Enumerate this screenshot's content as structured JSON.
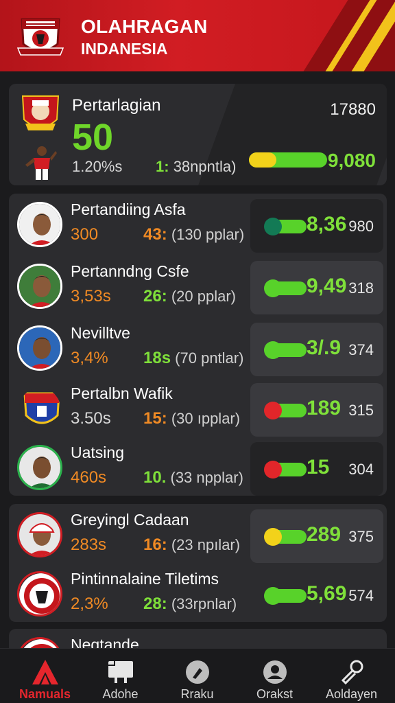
{
  "header": {
    "title": "OLAHRAGAN",
    "subtitle": "INDANESIA",
    "logo_icon": "club-crest-icon",
    "colors": {
      "primary": "#c4161c",
      "accent": "#f2c21b"
    }
  },
  "featured": {
    "title": "Pertarlagian",
    "score": "50",
    "percent": "1.20%s",
    "matches_num": "1:",
    "matches_text": "38npntla)",
    "count": "17880",
    "value": "9,080",
    "bar": {
      "left_color": "#f2d21a",
      "right_color": "#58d22a",
      "fill": 0.65
    }
  },
  "rows": [
    {
      "name": "Pertandiing Asfa",
      "pct": "300",
      "pct_color": "orange",
      "matches_num": "43:",
      "matches_num_color": "orange",
      "matches_text": "(130 pplar)",
      "value": "8,36",
      "sub": "980",
      "dot_color": "#137a55",
      "panel": "dark"
    },
    {
      "name": "Pertanndng Csfe",
      "pct": "3,53s",
      "pct_color": "orange",
      "matches_num": "26:",
      "matches_num_color": "green",
      "matches_text": "(20 pplar)",
      "value": "9,49",
      "sub": "318",
      "dot_color": "#58d22a",
      "panel": "light"
    },
    {
      "name": "Nevilltve",
      "pct": "3,4%",
      "pct_color": "orange",
      "matches_num": "18s",
      "matches_num_color": "green",
      "matches_text": "(70 pntlar)",
      "value": "3/.9",
      "sub": "374",
      "dot_color": "#58d22a",
      "panel": "light"
    },
    {
      "name": "Pertalbn Wafik",
      "pct": "3.50s",
      "pct_color": "white",
      "matches_num": "15:",
      "matches_num_color": "orange",
      "matches_text": "(30 ıpplar)",
      "value": "189",
      "sub": "315",
      "dot_color": "#e2262a",
      "panel": "light"
    },
    {
      "name": "Uatsing",
      "pct": "460s",
      "pct_color": "orange",
      "matches_num": "10.",
      "matches_num_color": "green",
      "matches_text": "(33 npplar)",
      "value": "15",
      "sub": "304",
      "dot_color": "#e2262a",
      "panel": "dark"
    },
    {
      "name": "Greyingl Cadaan",
      "pct": "283s",
      "pct_color": "orange",
      "matches_num": "16:",
      "matches_num_color": "orange",
      "matches_text": "(23 npılar)",
      "value": "289",
      "sub": "375",
      "dot_color": "#f2d21a",
      "panel": "light"
    },
    {
      "name": "Pintinnalaine Tiletims",
      "pct": "2,3%",
      "pct_color": "orange",
      "matches_num": "28:",
      "matches_num_color": "green",
      "matches_text": "(33rpnlar)",
      "value": "5,69",
      "sub": "574",
      "dot_color": "#58d22a",
      "panel": "none"
    },
    {
      "name": "Negtande",
      "pct": "",
      "pct_color": "orange",
      "matches_num": "",
      "matches_num_color": "green",
      "matches_text": "",
      "value": "",
      "sub": "",
      "dot_color": "#58d22a",
      "panel": "none"
    }
  ],
  "nav": [
    {
      "label": "Namuals",
      "icon": "home-triangle-icon",
      "active": true
    },
    {
      "label": "Adohe",
      "icon": "board-icon",
      "active": false
    },
    {
      "label": "Rraku",
      "icon": "ball-icon",
      "active": false
    },
    {
      "label": "Orakst",
      "icon": "profile-icon",
      "active": false
    },
    {
      "label": "Aoldayen",
      "icon": "settings-icon",
      "active": false
    }
  ]
}
